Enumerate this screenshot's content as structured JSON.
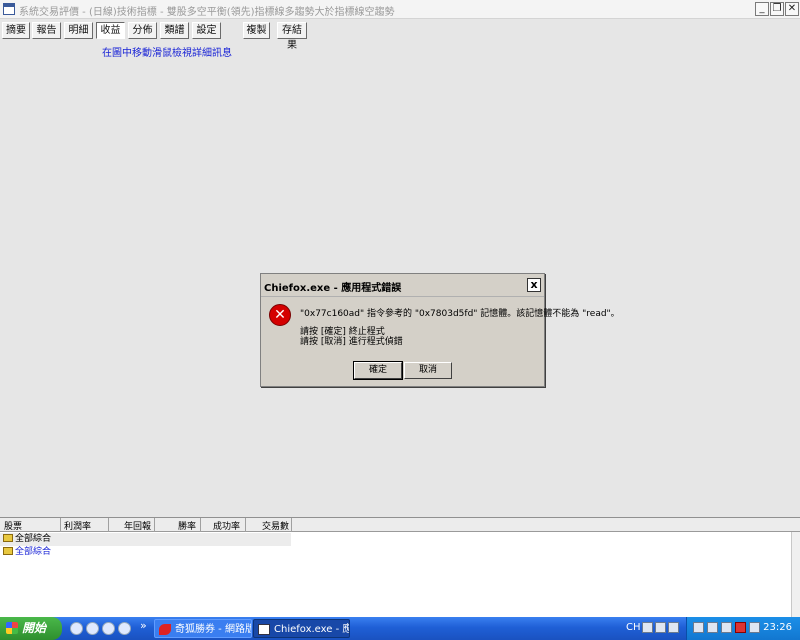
{
  "window": {
    "title": "系統交易評價 - (日線)技術指標 - 雙股多空平衡(領先)指標線多趨勢大於指標線空趨勢",
    "min_glyph": "_",
    "restore_glyph": "❐",
    "close_glyph": "✕"
  },
  "toolbar": {
    "buttons": [
      "摘要",
      "報告",
      "明細",
      "收益",
      "分佈",
      "類譜",
      "設定",
      "複製",
      "存結果"
    ],
    "active": "收益",
    "hint": "在圖中移動滑鼠檢視詳細訊息"
  },
  "dialog": {
    "title": "Chiefox.exe - 應用程式錯誤",
    "close_glyph": "x",
    "icon_glyph": "✕",
    "message": "\"0x77c160ad\" 指令參考的 \"0x7803d5fd\" 記憶體。該記憶體不能為 \"read\"。",
    "line1": "請按 [確定] 終止程式",
    "line2": "請按 [取消] 進行程式偵錯",
    "ok_label": "確定",
    "cancel_label": "取消"
  },
  "results_panel": {
    "columns": [
      "股票",
      "利潤率",
      "年回報",
      "勝率",
      "成功率",
      "交易數"
    ],
    "rows": [
      {
        "label": "全部綜合",
        "color": "#000000"
      },
      {
        "label": "全部綜合",
        "color": "#1a24d6"
      }
    ]
  },
  "taskbar": {
    "start_label": "開始",
    "chevron": "»",
    "tasks": [
      {
        "label": "奇狐勝券 - 網路版 - ...",
        "active": false
      },
      {
        "label": "Chiefox.exe - 應用程...",
        "active": true
      }
    ],
    "language": "CH",
    "clock": "23:26"
  }
}
